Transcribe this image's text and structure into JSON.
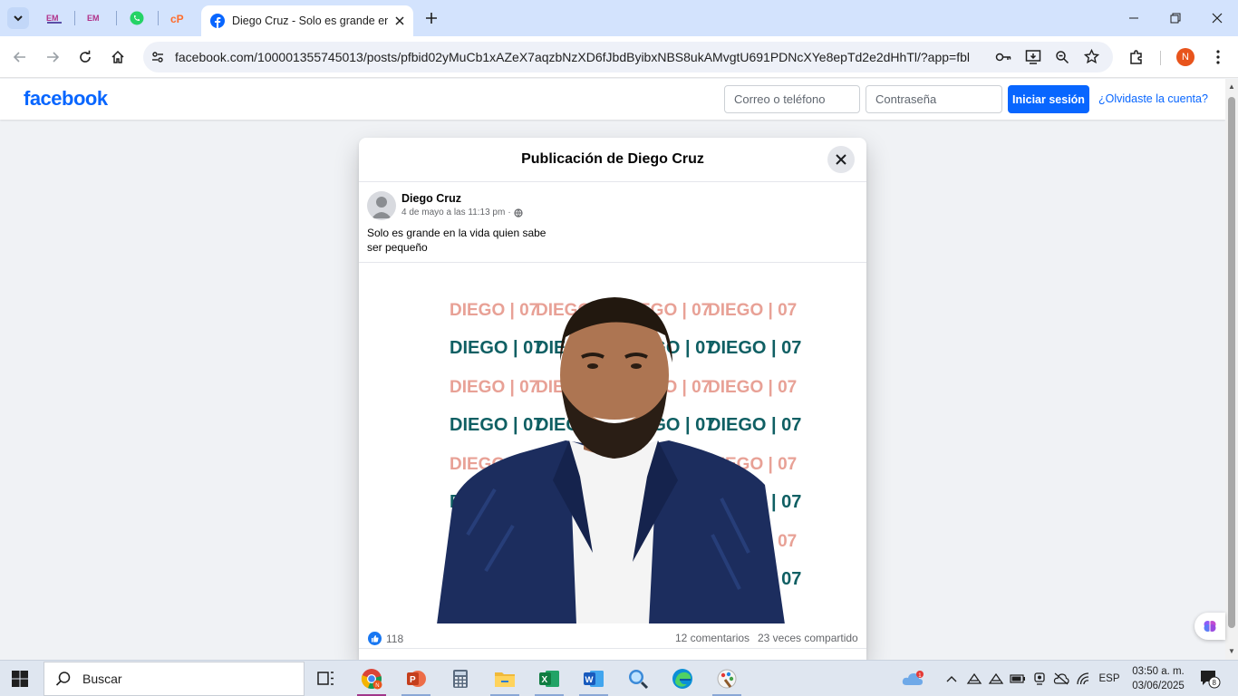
{
  "browser": {
    "active_tab": {
      "title": "Diego Cruz - Solo es grande en la vida quien sabe ser pequeño"
    },
    "address": {
      "url": "facebook.com/100001355745013/posts/pfbid02yMuCb1xAZeX7aqzbNzXD6fJbdByibxNBS8ukAMvgtU691PDNcXYe8epTd2e2dHhTl/?app=fbl"
    },
    "profile_initial": "N"
  },
  "facebook": {
    "logo": "facebook",
    "email_placeholder": "Correo o teléfono",
    "password_placeholder": "Contraseña",
    "login_label": "Iniciar sesión",
    "forgot_label": "¿Olvidaste la cuenta?"
  },
  "post": {
    "dialog_title": "Publicación de Diego Cruz",
    "author": "Diego Cruz",
    "timestamp": "4 de mayo a las 11:13 pm",
    "text_line1": "Solo es grande en la vida quien sabe",
    "text_line2": "ser pequeño",
    "banner_text": "DIEGO | 07",
    "likes": "118",
    "comments": "12 comentarios",
    "shares": "23 veces compartido"
  },
  "taskbar": {
    "search_placeholder": "Buscar",
    "language": "ESP",
    "time": "03:50 a. m.",
    "date": "03/06/2025",
    "weather_badge": "1",
    "notifications": "8"
  },
  "colors": {
    "fb_blue": "#0866ff",
    "banner_pink": "#e8a196",
    "banner_teal": "#0f5f63"
  }
}
